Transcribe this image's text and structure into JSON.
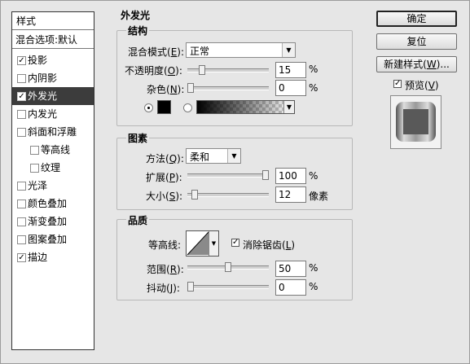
{
  "sidebar": {
    "title": "样式",
    "blend_options": "混合选项:默认",
    "items": [
      {
        "label": "投影",
        "checked": true,
        "indent": false,
        "selected": false
      },
      {
        "label": "内阴影",
        "checked": false,
        "indent": false,
        "selected": false
      },
      {
        "label": "外发光",
        "checked": true,
        "indent": false,
        "selected": true
      },
      {
        "label": "内发光",
        "checked": false,
        "indent": false,
        "selected": false
      },
      {
        "label": "斜面和浮雕",
        "checked": false,
        "indent": false,
        "selected": false
      },
      {
        "label": "等高线",
        "checked": false,
        "indent": true,
        "selected": false
      },
      {
        "label": "纹理",
        "checked": false,
        "indent": true,
        "selected": false
      },
      {
        "label": "光泽",
        "checked": false,
        "indent": false,
        "selected": false
      },
      {
        "label": "颜色叠加",
        "checked": false,
        "indent": false,
        "selected": false
      },
      {
        "label": "渐变叠加",
        "checked": false,
        "indent": false,
        "selected": false
      },
      {
        "label": "图案叠加",
        "checked": false,
        "indent": false,
        "selected": false
      },
      {
        "label": "描边",
        "checked": true,
        "indent": false,
        "selected": false
      }
    ]
  },
  "panel": {
    "title": "外发光",
    "structure": {
      "title": "结构",
      "blend_mode_label": "混合模式(",
      "blend_mode_key": "E",
      "blend_mode_value": "正常",
      "opacity_label": "不透明度(",
      "opacity_key": "O",
      "opacity_value": "15",
      "noise_label": "杂色(",
      "noise_key": "N",
      "noise_value": "0",
      "percent": "%",
      "colon_close": "):",
      "opacity_level": 0.15,
      "noise_level": 0.0,
      "color_swatch": "#000000"
    },
    "elements": {
      "title": "图素",
      "method_label": "方法(",
      "method_key": "Q",
      "method_value": "柔和",
      "spread_label": "扩展(",
      "spread_key": "P",
      "spread_value": "100",
      "size_label": "大小(",
      "size_key": "S",
      "size_value": "12",
      "size_unit": "像素",
      "spread_level": 1.0,
      "size_level": 0.05
    },
    "quality": {
      "title": "品质",
      "contour_label": "等高线:",
      "antialias_label": "消除锯齿(",
      "antialias_key": "L",
      "antialias_checked": true,
      "range_label": "范围(",
      "range_key": "R",
      "range_value": "50",
      "jitter_label": "抖动(",
      "jitter_key": "J",
      "jitter_value": "0",
      "range_level": 0.5,
      "jitter_level": 0.0
    }
  },
  "buttons": {
    "ok": "确定",
    "reset": "复位",
    "new_style": "新建样式(",
    "new_style_key": "W",
    "new_style_tail": ")...",
    "preview_label": "预览(",
    "preview_key": "V",
    "preview_checked": true
  },
  "colors": {
    "selected_bg": "#3c3c3c",
    "dialog_bg": "#e6e6e6"
  }
}
